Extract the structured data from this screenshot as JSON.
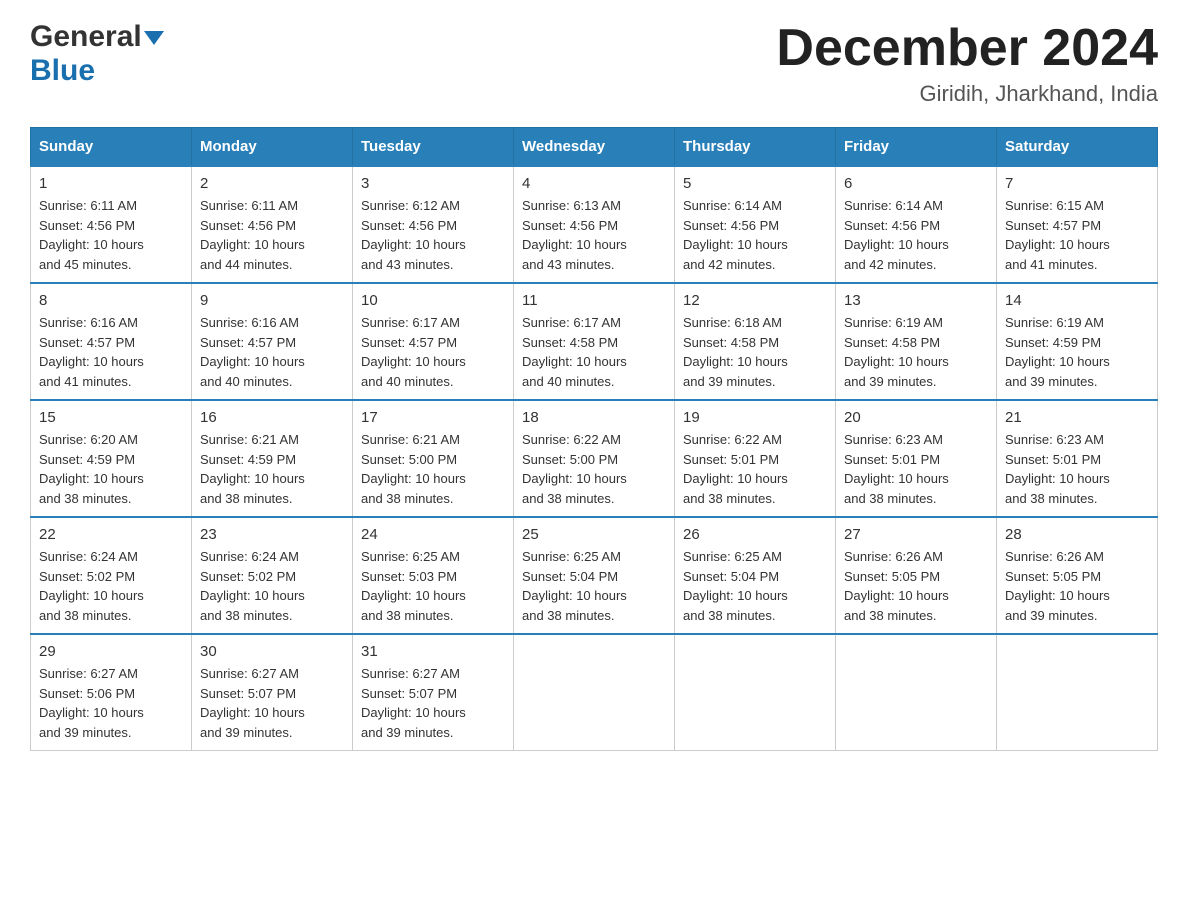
{
  "header": {
    "logo_general": "General",
    "logo_blue": "Blue",
    "title": "December 2024",
    "subtitle": "Giridih, Jharkhand, India"
  },
  "days_of_week": [
    "Sunday",
    "Monday",
    "Tuesday",
    "Wednesday",
    "Thursday",
    "Friday",
    "Saturday"
  ],
  "weeks": [
    [
      {
        "day": "1",
        "sunrise": "6:11 AM",
        "sunset": "4:56 PM",
        "daylight": "10 hours and 45 minutes."
      },
      {
        "day": "2",
        "sunrise": "6:11 AM",
        "sunset": "4:56 PM",
        "daylight": "10 hours and 44 minutes."
      },
      {
        "day": "3",
        "sunrise": "6:12 AM",
        "sunset": "4:56 PM",
        "daylight": "10 hours and 43 minutes."
      },
      {
        "day": "4",
        "sunrise": "6:13 AM",
        "sunset": "4:56 PM",
        "daylight": "10 hours and 43 minutes."
      },
      {
        "day": "5",
        "sunrise": "6:14 AM",
        "sunset": "4:56 PM",
        "daylight": "10 hours and 42 minutes."
      },
      {
        "day": "6",
        "sunrise": "6:14 AM",
        "sunset": "4:56 PM",
        "daylight": "10 hours and 42 minutes."
      },
      {
        "day": "7",
        "sunrise": "6:15 AM",
        "sunset": "4:57 PM",
        "daylight": "10 hours and 41 minutes."
      }
    ],
    [
      {
        "day": "8",
        "sunrise": "6:16 AM",
        "sunset": "4:57 PM",
        "daylight": "10 hours and 41 minutes."
      },
      {
        "day": "9",
        "sunrise": "6:16 AM",
        "sunset": "4:57 PM",
        "daylight": "10 hours and 40 minutes."
      },
      {
        "day": "10",
        "sunrise": "6:17 AM",
        "sunset": "4:57 PM",
        "daylight": "10 hours and 40 minutes."
      },
      {
        "day": "11",
        "sunrise": "6:17 AM",
        "sunset": "4:58 PM",
        "daylight": "10 hours and 40 minutes."
      },
      {
        "day": "12",
        "sunrise": "6:18 AM",
        "sunset": "4:58 PM",
        "daylight": "10 hours and 39 minutes."
      },
      {
        "day": "13",
        "sunrise": "6:19 AM",
        "sunset": "4:58 PM",
        "daylight": "10 hours and 39 minutes."
      },
      {
        "day": "14",
        "sunrise": "6:19 AM",
        "sunset": "4:59 PM",
        "daylight": "10 hours and 39 minutes."
      }
    ],
    [
      {
        "day": "15",
        "sunrise": "6:20 AM",
        "sunset": "4:59 PM",
        "daylight": "10 hours and 38 minutes."
      },
      {
        "day": "16",
        "sunrise": "6:21 AM",
        "sunset": "4:59 PM",
        "daylight": "10 hours and 38 minutes."
      },
      {
        "day": "17",
        "sunrise": "6:21 AM",
        "sunset": "5:00 PM",
        "daylight": "10 hours and 38 minutes."
      },
      {
        "day": "18",
        "sunrise": "6:22 AM",
        "sunset": "5:00 PM",
        "daylight": "10 hours and 38 minutes."
      },
      {
        "day": "19",
        "sunrise": "6:22 AM",
        "sunset": "5:01 PM",
        "daylight": "10 hours and 38 minutes."
      },
      {
        "day": "20",
        "sunrise": "6:23 AM",
        "sunset": "5:01 PM",
        "daylight": "10 hours and 38 minutes."
      },
      {
        "day": "21",
        "sunrise": "6:23 AM",
        "sunset": "5:01 PM",
        "daylight": "10 hours and 38 minutes."
      }
    ],
    [
      {
        "day": "22",
        "sunrise": "6:24 AM",
        "sunset": "5:02 PM",
        "daylight": "10 hours and 38 minutes."
      },
      {
        "day": "23",
        "sunrise": "6:24 AM",
        "sunset": "5:02 PM",
        "daylight": "10 hours and 38 minutes."
      },
      {
        "day": "24",
        "sunrise": "6:25 AM",
        "sunset": "5:03 PM",
        "daylight": "10 hours and 38 minutes."
      },
      {
        "day": "25",
        "sunrise": "6:25 AM",
        "sunset": "5:04 PM",
        "daylight": "10 hours and 38 minutes."
      },
      {
        "day": "26",
        "sunrise": "6:25 AM",
        "sunset": "5:04 PM",
        "daylight": "10 hours and 38 minutes."
      },
      {
        "day": "27",
        "sunrise": "6:26 AM",
        "sunset": "5:05 PM",
        "daylight": "10 hours and 38 minutes."
      },
      {
        "day": "28",
        "sunrise": "6:26 AM",
        "sunset": "5:05 PM",
        "daylight": "10 hours and 39 minutes."
      }
    ],
    [
      {
        "day": "29",
        "sunrise": "6:27 AM",
        "sunset": "5:06 PM",
        "daylight": "10 hours and 39 minutes."
      },
      {
        "day": "30",
        "sunrise": "6:27 AM",
        "sunset": "5:07 PM",
        "daylight": "10 hours and 39 minutes."
      },
      {
        "day": "31",
        "sunrise": "6:27 AM",
        "sunset": "5:07 PM",
        "daylight": "10 hours and 39 minutes."
      },
      null,
      null,
      null,
      null
    ]
  ],
  "labels": {
    "sunrise": "Sunrise:",
    "sunset": "Sunset:",
    "daylight": "Daylight:"
  }
}
